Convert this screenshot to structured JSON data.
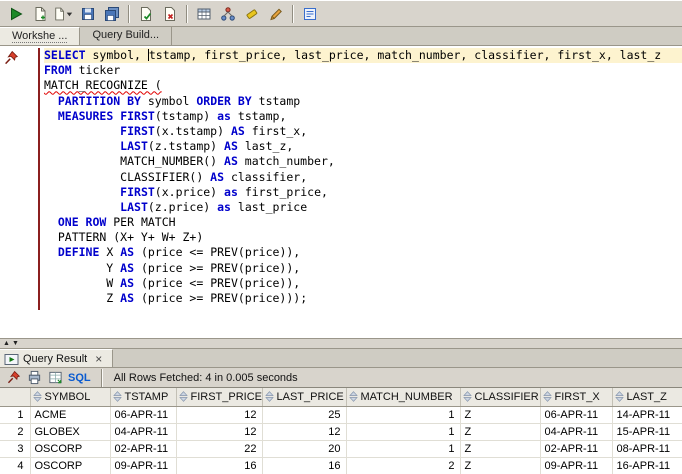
{
  "icons": {
    "collapse_up": "▲",
    "collapse_down": "▼"
  },
  "main_toolbar": {
    "items": [
      {
        "name": "run-statement-icon"
      },
      {
        "name": "new-file-icon"
      },
      {
        "name": "open-file-dropdown-icon"
      },
      {
        "name": "save-icon"
      },
      {
        "name": "save-all-icon"
      },
      {
        "name": "separator"
      },
      {
        "name": "commit-icon"
      },
      {
        "name": "rollback-icon"
      },
      {
        "name": "separator"
      },
      {
        "name": "query-builder-icon"
      },
      {
        "name": "explain-plan-icon"
      },
      {
        "name": "clear-icon"
      },
      {
        "name": "format-icon"
      },
      {
        "name": "separator"
      },
      {
        "name": "snippets-icon"
      }
    ]
  },
  "tabs": [
    {
      "label": "Workshe ..."
    },
    {
      "label": "Query Build..."
    }
  ],
  "editor": {
    "lines": [
      {
        "current": true,
        "tokens": [
          {
            "t": "kw",
            "x": "SELECT"
          },
          {
            "t": "p",
            "x": " symbol, "
          },
          {
            "t": "caret"
          },
          {
            "t": "p",
            "x": "tstamp, first_price, last_price, match_number, classifier, first_x, last_z"
          }
        ]
      },
      {
        "tokens": [
          {
            "t": "kw",
            "x": "FROM"
          },
          {
            "t": "p",
            "x": " ticker"
          }
        ]
      },
      {
        "tokens": [
          {
            "t": "err",
            "x": "MATCH_RECOGNIZE ("
          }
        ]
      },
      {
        "tokens": [
          {
            "t": "p",
            "x": "  "
          },
          {
            "t": "kw",
            "x": "PARTITION BY"
          },
          {
            "t": "p",
            "x": " symbol "
          },
          {
            "t": "kw",
            "x": "ORDER BY"
          },
          {
            "t": "p",
            "x": " tstamp"
          }
        ]
      },
      {
        "tokens": [
          {
            "t": "p",
            "x": "  "
          },
          {
            "t": "kw",
            "x": "MEASURES"
          },
          {
            "t": "p",
            "x": " "
          },
          {
            "t": "kw",
            "x": "FIRST"
          },
          {
            "t": "p",
            "x": "(tstamp) "
          },
          {
            "t": "kw",
            "x": "as"
          },
          {
            "t": "p",
            "x": " tstamp,"
          }
        ]
      },
      {
        "tokens": [
          {
            "t": "p",
            "x": "           "
          },
          {
            "t": "kw",
            "x": "FIRST"
          },
          {
            "t": "p",
            "x": "(x.tstamp) "
          },
          {
            "t": "kw",
            "x": "AS"
          },
          {
            "t": "p",
            "x": " first_x,"
          }
        ]
      },
      {
        "tokens": [
          {
            "t": "p",
            "x": "           "
          },
          {
            "t": "kw",
            "x": "LAST"
          },
          {
            "t": "p",
            "x": "(z.tstamp) "
          },
          {
            "t": "kw",
            "x": "AS"
          },
          {
            "t": "p",
            "x": " last_z,"
          }
        ]
      },
      {
        "tokens": [
          {
            "t": "p",
            "x": "           MATCH_NUMBER() "
          },
          {
            "t": "kw",
            "x": "AS"
          },
          {
            "t": "p",
            "x": " match_number,"
          }
        ]
      },
      {
        "tokens": [
          {
            "t": "p",
            "x": "           CLASSIFIER() "
          },
          {
            "t": "kw",
            "x": "AS"
          },
          {
            "t": "p",
            "x": " classifier,"
          }
        ]
      },
      {
        "tokens": [
          {
            "t": "p",
            "x": "           "
          },
          {
            "t": "kw",
            "x": "FIRST"
          },
          {
            "t": "p",
            "x": "(x.price) "
          },
          {
            "t": "kw",
            "x": "as"
          },
          {
            "t": "p",
            "x": " first_price,"
          }
        ]
      },
      {
        "tokens": [
          {
            "t": "p",
            "x": "           "
          },
          {
            "t": "kw",
            "x": "LAST"
          },
          {
            "t": "p",
            "x": "(z.price) "
          },
          {
            "t": "kw",
            "x": "as"
          },
          {
            "t": "p",
            "x": " last_price"
          }
        ]
      },
      {
        "tokens": [
          {
            "t": "p",
            "x": "  "
          },
          {
            "t": "kw",
            "x": "ONE ROW"
          },
          {
            "t": "p",
            "x": " PER MATCH"
          }
        ]
      },
      {
        "tokens": [
          {
            "t": "p",
            "x": "  PATTERN (X+ Y+ W+ Z+)"
          }
        ]
      },
      {
        "tokens": [
          {
            "t": "p",
            "x": "  "
          },
          {
            "t": "kw",
            "x": "DEFINE"
          },
          {
            "t": "p",
            "x": " X "
          },
          {
            "t": "kw",
            "x": "AS"
          },
          {
            "t": "p",
            "x": " (price <= PREV(price)),"
          }
        ]
      },
      {
        "tokens": [
          {
            "t": "p",
            "x": "         Y "
          },
          {
            "t": "kw",
            "x": "AS"
          },
          {
            "t": "p",
            "x": " (price >= PREV(price)),"
          }
        ]
      },
      {
        "tokens": [
          {
            "t": "p",
            "x": "         W "
          },
          {
            "t": "kw",
            "x": "AS"
          },
          {
            "t": "p",
            "x": " (price <= PREV(price)),"
          }
        ]
      },
      {
        "tokens": [
          {
            "t": "p",
            "x": "         Z "
          },
          {
            "t": "kw",
            "x": "AS"
          },
          {
            "t": "p",
            "x": " (price >= PREV(price)));"
          }
        ]
      }
    ]
  },
  "result_panel": {
    "tab_label": "Query Result",
    "close_label": "×",
    "toolbar": {
      "items": [
        {
          "name": "pin-icon"
        },
        {
          "name": "print-icon"
        },
        {
          "name": "fetch-icon"
        }
      ],
      "sql_label": "SQL",
      "status": "All Rows Fetched: 4 in 0.005 seconds"
    }
  },
  "results": {
    "columns": [
      {
        "label": "SYMBOL",
        "align": "left"
      },
      {
        "label": "TSTAMP",
        "align": "left"
      },
      {
        "label": "FIRST_PRICE",
        "align": "right"
      },
      {
        "label": "LAST_PRICE",
        "align": "right"
      },
      {
        "label": "MATCH_NUMBER",
        "align": "right"
      },
      {
        "label": "CLASSIFIER",
        "align": "left"
      },
      {
        "label": "FIRST_X",
        "align": "left"
      },
      {
        "label": "LAST_Z",
        "align": "left"
      }
    ],
    "rows": [
      {
        "num": "1",
        "cells": [
          "ACME",
          "06-APR-11",
          "12",
          "25",
          "1",
          "Z",
          "06-APR-11",
          "14-APR-11"
        ]
      },
      {
        "num": "2",
        "cells": [
          "GLOBEX",
          "04-APR-11",
          "12",
          "12",
          "1",
          "Z",
          "04-APR-11",
          "15-APR-11"
        ]
      },
      {
        "num": "3",
        "cells": [
          "OSCORP",
          "02-APR-11",
          "22",
          "20",
          "1",
          "Z",
          "02-APR-11",
          "08-APR-11"
        ]
      },
      {
        "num": "4",
        "cells": [
          "OSCORP",
          "09-APR-11",
          "16",
          "16",
          "2",
          "Z",
          "09-APR-11",
          "16-APR-11"
        ]
      }
    ]
  }
}
